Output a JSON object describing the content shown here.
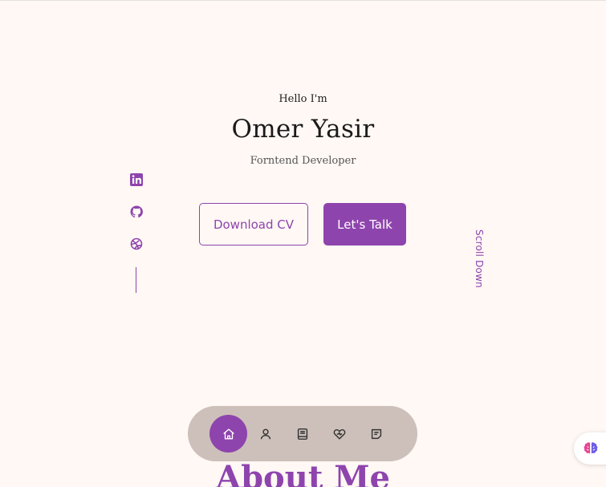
{
  "hero": {
    "greeting": "Hello I'm",
    "name": "Omer Yasir",
    "role": "Forntend Developer",
    "download_cv_label": "Download CV",
    "lets_talk_label": "Let's Talk",
    "scroll_down_label": "Scroll Down"
  },
  "social": [
    {
      "icon": "linkedin-icon"
    },
    {
      "icon": "github-icon"
    },
    {
      "icon": "dribbble-icon"
    }
  ],
  "nav": {
    "items": [
      {
        "icon": "home-icon",
        "active": true
      },
      {
        "icon": "user-icon",
        "active": false
      },
      {
        "icon": "book-icon",
        "active": false
      },
      {
        "icon": "services-icon",
        "active": false
      },
      {
        "icon": "message-icon",
        "active": false
      }
    ]
  },
  "section": {
    "about_title": "About Me"
  },
  "colors": {
    "accent": "#8e44ad",
    "background": "#fff8f5",
    "nav_background": "#c8b9b4"
  }
}
